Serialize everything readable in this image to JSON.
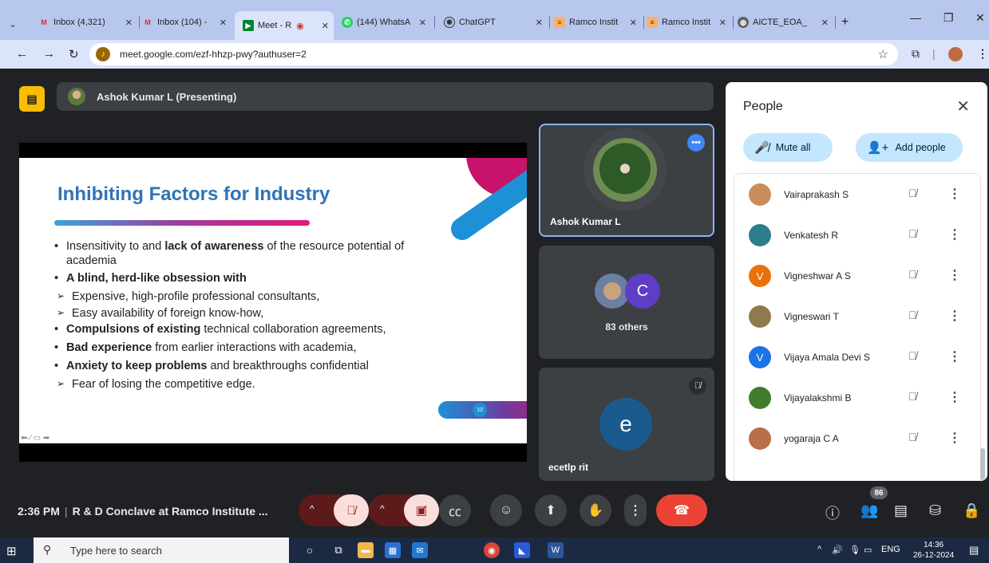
{
  "browser": {
    "tabs": [
      {
        "label": "Inbox (4,321)",
        "icon": "gmail-icon"
      },
      {
        "label": "Inbox (104) -",
        "icon": "gmail-icon"
      },
      {
        "label": "Meet - R",
        "icon": "meet-icon",
        "active": true
      },
      {
        "label": "(144) WhatsA",
        "icon": "whatsapp-icon"
      },
      {
        "label": "ChatGPT",
        "icon": "chatgpt-icon"
      },
      {
        "label": "Ramco Instit",
        "icon": "ramco-icon"
      },
      {
        "label": "Ramco Instit",
        "icon": "ramco-icon"
      },
      {
        "label": "AICTE_EOA_",
        "icon": "globe-icon"
      }
    ],
    "new_tab": "+",
    "url": "meet.google.com/ezf-hhzp-pwy?authuser=2"
  },
  "presenter": {
    "label": "Ashok Kumar L (Presenting)"
  },
  "slide": {
    "title": "Inhibiting Factors for Industry",
    "page_number": "10",
    "bullets": [
      {
        "level": 1,
        "pre": "Insensitivity to and ",
        "bold": "lack of awareness",
        "post": " of the resource potential of academia"
      },
      {
        "level": 1,
        "pre": "",
        "bold": "A blind, herd-like obsession with",
        "post": ""
      },
      {
        "level": 2,
        "pre": "Expensive, high-profile professional consultants,",
        "bold": "",
        "post": ""
      },
      {
        "level": 2,
        "pre": "Easy availability of foreign know-how,",
        "bold": "",
        "post": ""
      },
      {
        "level": 1,
        "pre": "",
        "bold": "Compulsions of existing",
        "post": " technical collaboration agreements,"
      },
      {
        "level": 1,
        "pre": "",
        "bold": "Bad experience",
        "post": " from earlier interactions with academia,"
      },
      {
        "level": 1,
        "pre": "",
        "bold": "Anxiety to keep problems",
        "post": " and breakthroughs confidential"
      },
      {
        "level": 2,
        "pre": "Fear of losing the competitive edge.",
        "bold": "",
        "post": ""
      }
    ]
  },
  "tiles": {
    "main_name": "Ashok Kumar L",
    "others_initial": "C",
    "others_label": "83 others",
    "third_initial": "e",
    "third_name": "ecetlp rit"
  },
  "people_panel": {
    "title": "People",
    "mute_all": "Mute all",
    "add_people": "Add people",
    "participants": [
      {
        "name": "Vairaprakash S",
        "initial": "",
        "color": "#c98d5a"
      },
      {
        "name": "Venkatesh R",
        "initial": "",
        "color": "#2e7d8c"
      },
      {
        "name": "Vigneshwar A S",
        "initial": "V",
        "color": "#e8710a"
      },
      {
        "name": "Vigneswari T",
        "initial": "",
        "color": "#8e7a4c"
      },
      {
        "name": "Vijaya Amala Devi S",
        "initial": "V",
        "color": "#1a73e8"
      },
      {
        "name": "Vijayalakshmi B",
        "initial": "",
        "color": "#3f7d2a"
      },
      {
        "name": "yogaraja C A",
        "initial": "",
        "color": "#b86f4a"
      }
    ]
  },
  "callbar": {
    "time": "2:36 PM",
    "meeting": "R & D Conclave at Ramco Institute ...",
    "participant_count": "86"
  },
  "taskbar": {
    "search_placeholder": "Type here to search",
    "lang": "ENG",
    "time": "14:36",
    "date": "26-12-2024"
  }
}
